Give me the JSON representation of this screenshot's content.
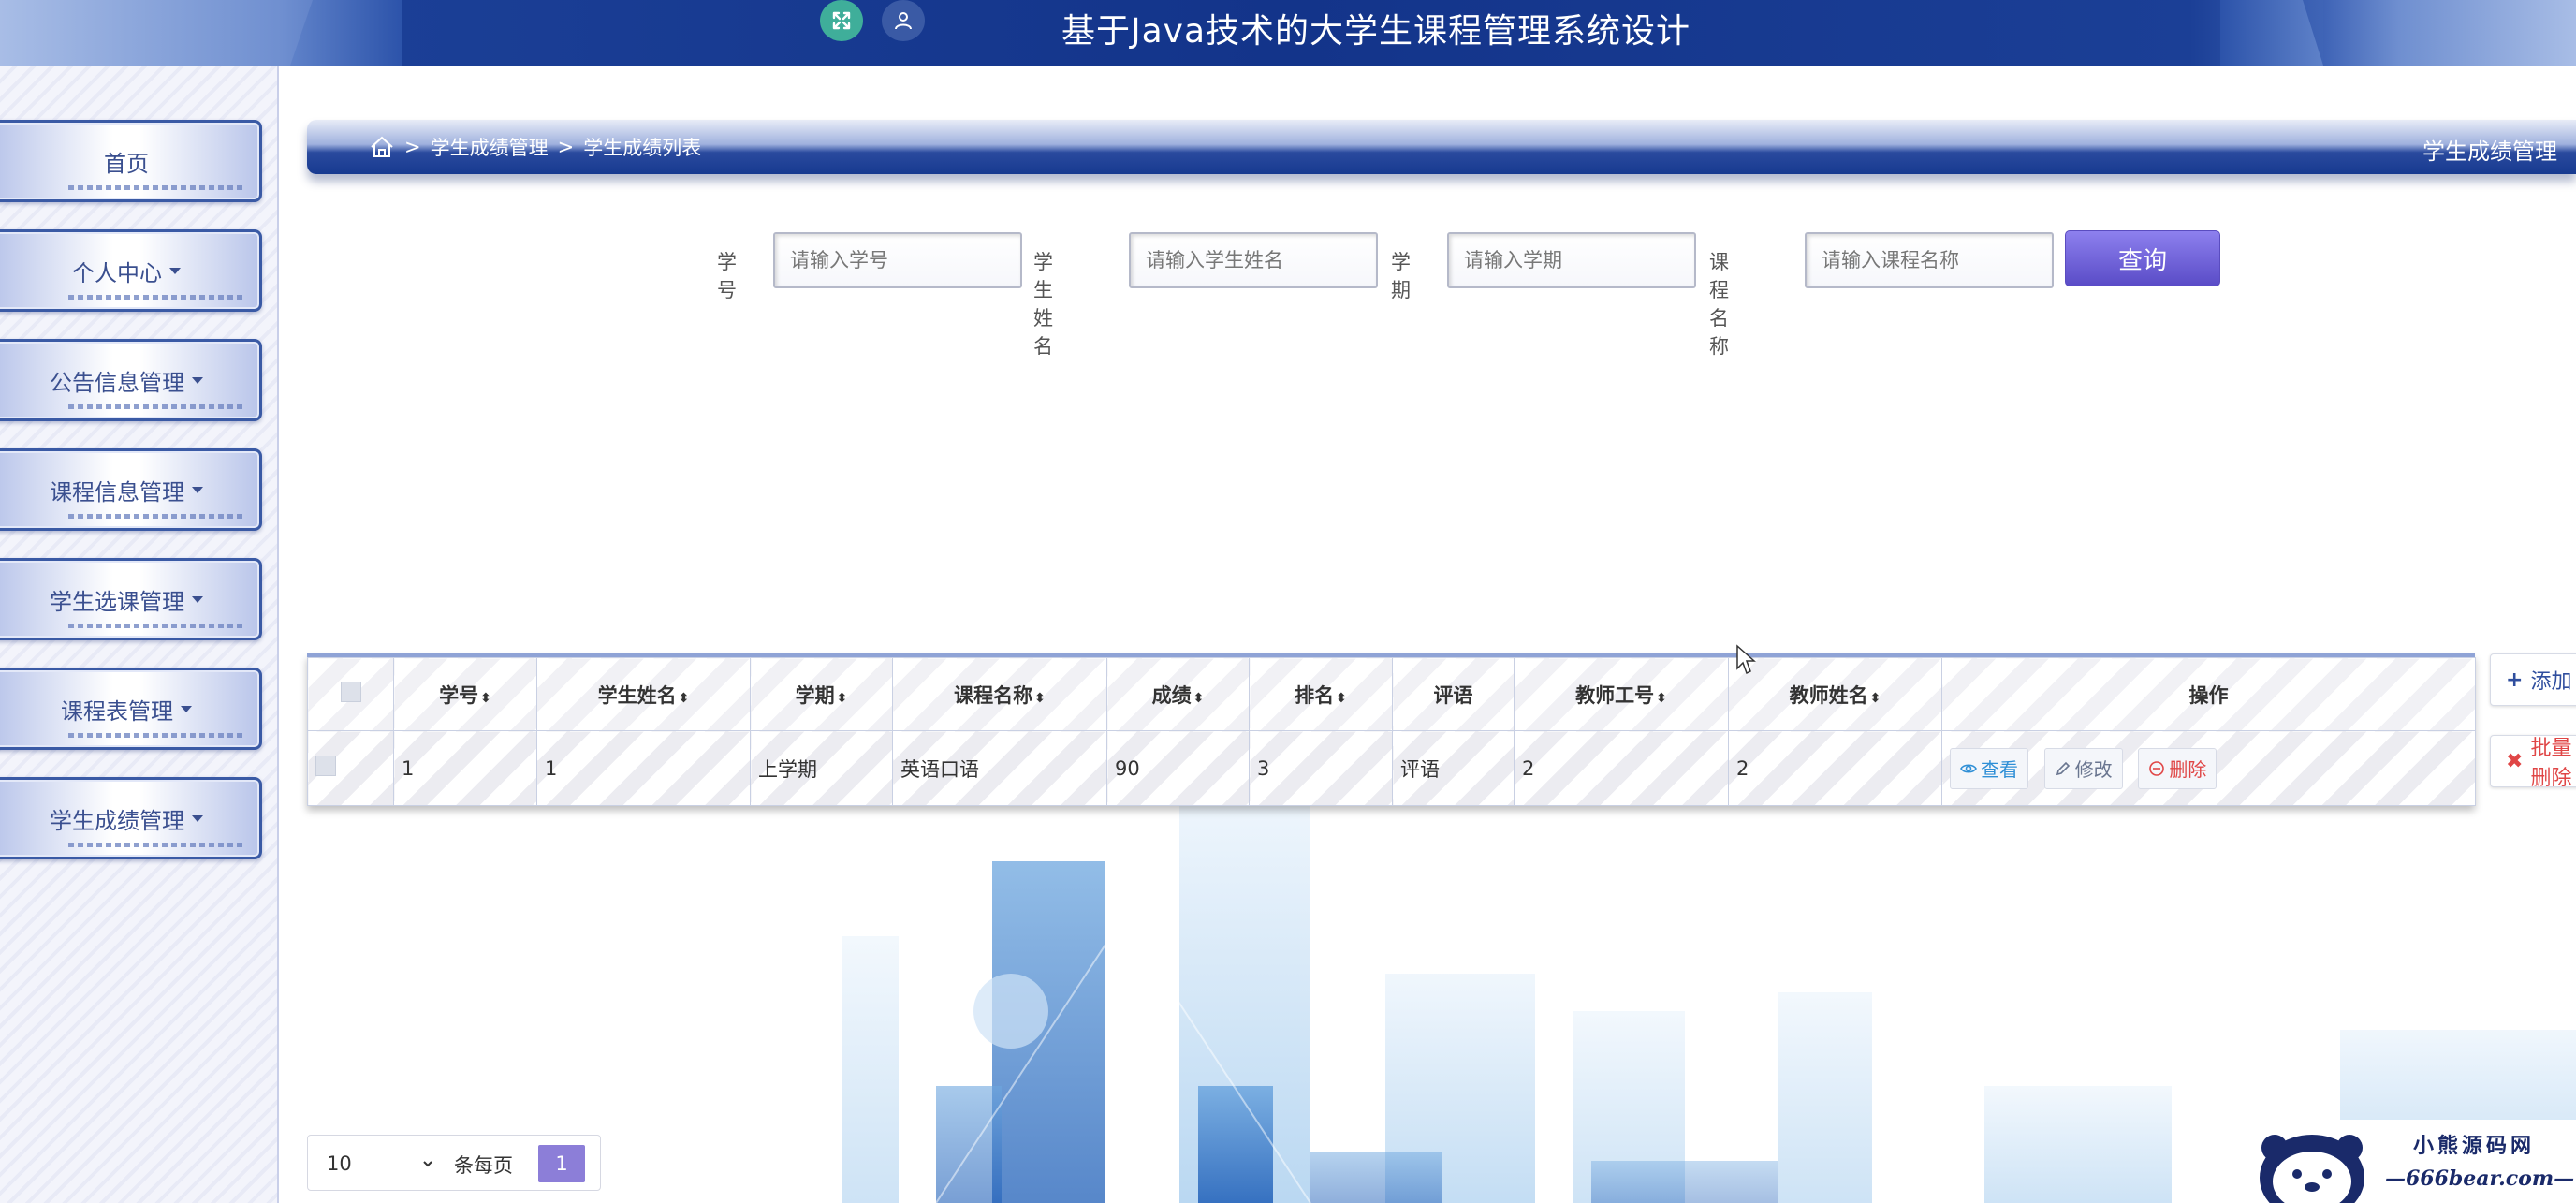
{
  "header": {
    "title": "基于Java技术的大学生课程管理系统设计",
    "icons": [
      "expand-icon",
      "user-icon"
    ]
  },
  "sidebar": {
    "items": [
      {
        "label": "首页",
        "has_caret": false
      },
      {
        "label": "个人中心",
        "has_caret": true
      },
      {
        "label": "公告信息管理",
        "has_caret": true
      },
      {
        "label": "课程信息管理",
        "has_caret": true
      },
      {
        "label": "学生选课管理",
        "has_caret": true
      },
      {
        "label": "课程表管理",
        "has_caret": true
      },
      {
        "label": "学生成绩管理",
        "has_caret": true
      }
    ]
  },
  "breadcrumb": {
    "separator": ">",
    "level1": "学生成绩管理",
    "level2": "学生成绩列表",
    "page_title": "学生成绩管理"
  },
  "search": {
    "fields": [
      {
        "label": "学号",
        "placeholder": "请输入学号"
      },
      {
        "label": "学生姓名",
        "placeholder": "请输入学生姓名"
      },
      {
        "label": "学期",
        "placeholder": "请输入学期"
      },
      {
        "label": "课程名称",
        "placeholder": "请输入课程名称"
      }
    ],
    "button_label": "查询"
  },
  "table": {
    "columns": [
      "学号",
      "学生姓名",
      "学期",
      "课程名称",
      "成绩",
      "排名",
      "评语",
      "教师工号",
      "教师姓名",
      "操作"
    ],
    "sort_glyph": "⬍",
    "rows": [
      {
        "student_id": "1",
        "student_name": "1",
        "term": "上学期",
        "course": "英语口语",
        "score": "90",
        "rank": "3",
        "comment": "评语",
        "teacher_id": "2",
        "teacher_name": "2"
      }
    ],
    "actions": {
      "view": "查看",
      "edit": "修改",
      "delete": "删除"
    }
  },
  "side_actions": {
    "add": "添加",
    "batch_delete": "批量删除"
  },
  "pagination": {
    "page_size": "10",
    "page_size_label": "条每页",
    "current_page": "1"
  },
  "watermark": {
    "line1": "小熊源码网",
    "line2": "—666bear.com—"
  },
  "colors": {
    "header_blue": "#13348a",
    "accent_purple": "#6a5cd8",
    "danger": "#e04646",
    "info": "#2f8fd6"
  }
}
